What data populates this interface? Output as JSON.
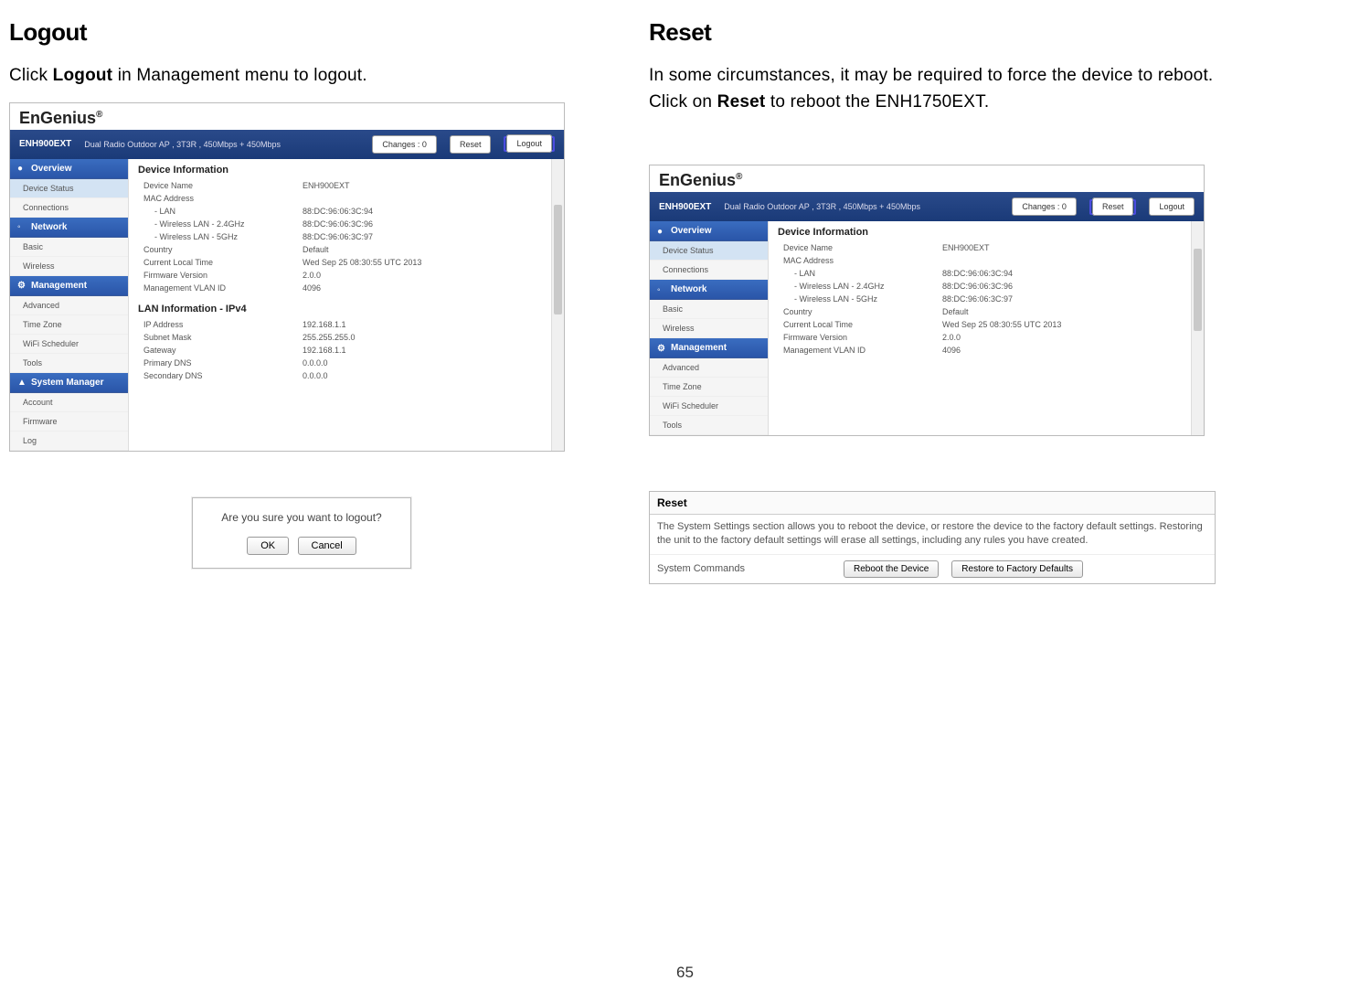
{
  "page_number": "65",
  "left": {
    "heading": "Logout",
    "text_before": "Click ",
    "text_bold": "Logout",
    "text_after": " in Management menu to logout.",
    "dialog": {
      "message": "Are you sure you want to logout?",
      "ok": "OK",
      "cancel": "Cancel"
    }
  },
  "right": {
    "heading": "Reset",
    "text_before": "In some circumstances, it may be required to force the device to reboot. Click on ",
    "text_bold": "Reset",
    "text_after": " to reboot the ENH1750EXT.",
    "reset_panel": {
      "title": "Reset",
      "body": "The System Settings section allows you to reboot the device, or restore the device to the factory default settings. Restoring the unit to the factory default settings will erase all settings, including any rules you have created.",
      "cmd_label": "System Commands",
      "reboot_btn": "Reboot the Device",
      "restore_btn": "Restore to Factory Defaults"
    }
  },
  "router_left": {
    "brand": "EnGenius",
    "brand_suffix": "®",
    "model": "ENH900EXT",
    "desc": "Dual Radio Outdoor AP , 3T3R , 450Mbps + 450Mbps",
    "changes_btn": "Changes : 0",
    "reset_btn": "Reset",
    "logout_btn": "Logout",
    "sidebar": {
      "overview": "Overview",
      "device_status": "Device Status",
      "connections": "Connections",
      "network": "Network",
      "basic": "Basic",
      "wireless": "Wireless",
      "management": "Management",
      "advanced": "Advanced",
      "time_zone": "Time Zone",
      "wifi_scheduler": "WiFi Scheduler",
      "tools": "Tools",
      "system_manager": "System Manager",
      "account": "Account",
      "firmware": "Firmware",
      "log": "Log"
    },
    "section1_title": "Device Information",
    "section2_title": "LAN Information - IPv4",
    "info1": [
      {
        "label": "Device Name",
        "value": "ENH900EXT"
      },
      {
        "label": "MAC Address",
        "value": ""
      },
      {
        "label": "- LAN",
        "value": "88:DC:96:06:3C:94",
        "indent": true
      },
      {
        "label": "- Wireless LAN - 2.4GHz",
        "value": "88:DC:96:06:3C:96",
        "indent": true
      },
      {
        "label": "- Wireless LAN - 5GHz",
        "value": "88:DC:96:06:3C:97",
        "indent": true
      },
      {
        "label": "Country",
        "value": "Default"
      },
      {
        "label": "Current Local Time",
        "value": "Wed Sep 25 08:30:55 UTC 2013"
      },
      {
        "label": "Firmware Version",
        "value": "2.0.0"
      },
      {
        "label": "Management VLAN ID",
        "value": "4096"
      }
    ],
    "info2": [
      {
        "label": "IP Address",
        "value": "192.168.1.1"
      },
      {
        "label": "Subnet Mask",
        "value": "255.255.255.0"
      },
      {
        "label": "Gateway",
        "value": "192.168.1.1"
      },
      {
        "label": "Primary DNS",
        "value": "0.0.0.0"
      },
      {
        "label": "Secondary DNS",
        "value": "0.0.0.0"
      }
    ]
  },
  "router_right": {
    "brand": "EnGenius",
    "brand_suffix": "®",
    "model": "ENH900EXT",
    "desc": "Dual Radio Outdoor AP , 3T3R , 450Mbps + 450Mbps",
    "changes_btn": "Changes : 0",
    "reset_btn": "Reset",
    "logout_btn": "Logout",
    "sidebar": {
      "overview": "Overview",
      "device_status": "Device Status",
      "connections": "Connections",
      "network": "Network",
      "basic": "Basic",
      "wireless": "Wireless",
      "management": "Management",
      "advanced": "Advanced",
      "time_zone": "Time Zone",
      "wifi_scheduler": "WiFi Scheduler",
      "tools": "Tools"
    },
    "section1_title": "Device Information",
    "info1": [
      {
        "label": "Device Name",
        "value": "ENH900EXT"
      },
      {
        "label": "MAC Address",
        "value": ""
      },
      {
        "label": "- LAN",
        "value": "88:DC:96:06:3C:94",
        "indent": true
      },
      {
        "label": "- Wireless LAN - 2.4GHz",
        "value": "88:DC:96:06:3C:96",
        "indent": true
      },
      {
        "label": "- Wireless LAN - 5GHz",
        "value": "88:DC:96:06:3C:97",
        "indent": true
      },
      {
        "label": "Country",
        "value": "Default"
      },
      {
        "label": "Current Local Time",
        "value": "Wed Sep 25 08:30:55 UTC 2013"
      },
      {
        "label": "Firmware Version",
        "value": "2.0.0"
      },
      {
        "label": "Management VLAN ID",
        "value": "4096"
      }
    ]
  }
}
